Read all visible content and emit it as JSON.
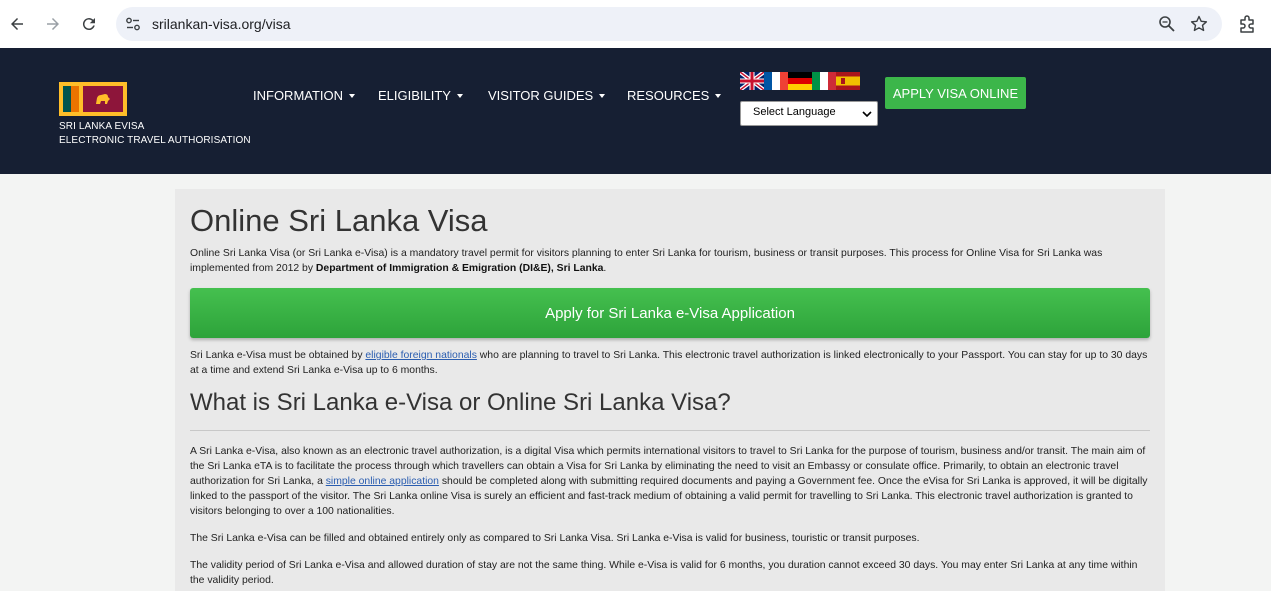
{
  "browser": {
    "url": "srilankan-visa.org/visa"
  },
  "header": {
    "brand_line1": "SRI LANKA EVISA",
    "brand_line2": "ELECTRONIC TRAVEL AUTHORISATION",
    "menu": [
      {
        "label": "INFORMATION"
      },
      {
        "label": "ELIGIBILITY"
      },
      {
        "label": "VISITOR GUIDES"
      },
      {
        "label": "RESOURCES"
      }
    ],
    "language_select": "Select Language",
    "language_flags": [
      "uk-flag-icon",
      "france-flag-icon",
      "germany-flag-icon",
      "italy-flag-icon",
      "spain-flag-icon"
    ],
    "apply_button": "APPLY VISA ONLINE"
  },
  "main": {
    "title": "Online Sri Lanka Visa",
    "intro_pre": "Online Sri Lanka Visa (or Sri Lanka e-Visa) is a mandatory travel permit for visitors planning to enter Sri Lanka for tourism, business or transit purposes. This process for Online Visa for Sri Lanka was implemented from 2012 by ",
    "intro_bold": "Department of Immigration & Emigration (DI&E), Sri Lanka",
    "intro_post": ".",
    "apply_button": "Apply for Sri Lanka e-Visa Application",
    "p2_pre": "Sri Lanka e-Visa must be obtained by ",
    "p2_link": "eligible foreign nationals",
    "p2_post": " who are planning to travel to Sri Lanka. This electronic travel authorization is linked electronically to your Passport. You can stay for up to 30 days at a time and extend Sri Lanka e-Visa up to 6 months.",
    "subtitle": "What is Sri Lanka e-Visa or Online Sri Lanka Visa?",
    "p3_pre": "A Sri Lanka e-Visa, also known as an electronic travel authorization, is a digital Visa which permits international visitors to travel to Sri Lanka for the purpose of tourism, business and/or transit. The main aim of the Sri Lanka eTA is to facilitate the process through which travellers can obtain a Visa for Sri Lanka by eliminating the need to visit an Embassy or consulate office. Primarily, to obtain an electronic travel authorization for Sri Lanka, a ",
    "p3_link": "simple online application",
    "p3_post": " should be completed along with submitting required documents and paying a Government fee. Once the eVisa for Sri Lanka is approved, it will be digitally linked to the passport of the visitor. The Sri Lanka online Visa is surely an efficient and fast-track medium of obtaining a valid permit for travelling to Sri Lanka. This electronic travel authorization is granted to visitors belonging to over a 100 nationalities.",
    "p4": "The Sri Lanka e-Visa can be filled and obtained entirely only as compared to Sri Lanka Visa. Sri Lanka e-Visa is valid for business, touristic or transit purposes.",
    "p5": "The validity period of Sri Lanka e-Visa and allowed duration of stay are not the same thing. While e-Visa is valid for 6 months, you duration cannot exceed 30 days. You may enter Sri Lanka at any time within the validity period."
  },
  "colors": {
    "header_bg": "#161f33",
    "apply_green": "#3cb64a",
    "content_bg": "#e9e9e9"
  }
}
